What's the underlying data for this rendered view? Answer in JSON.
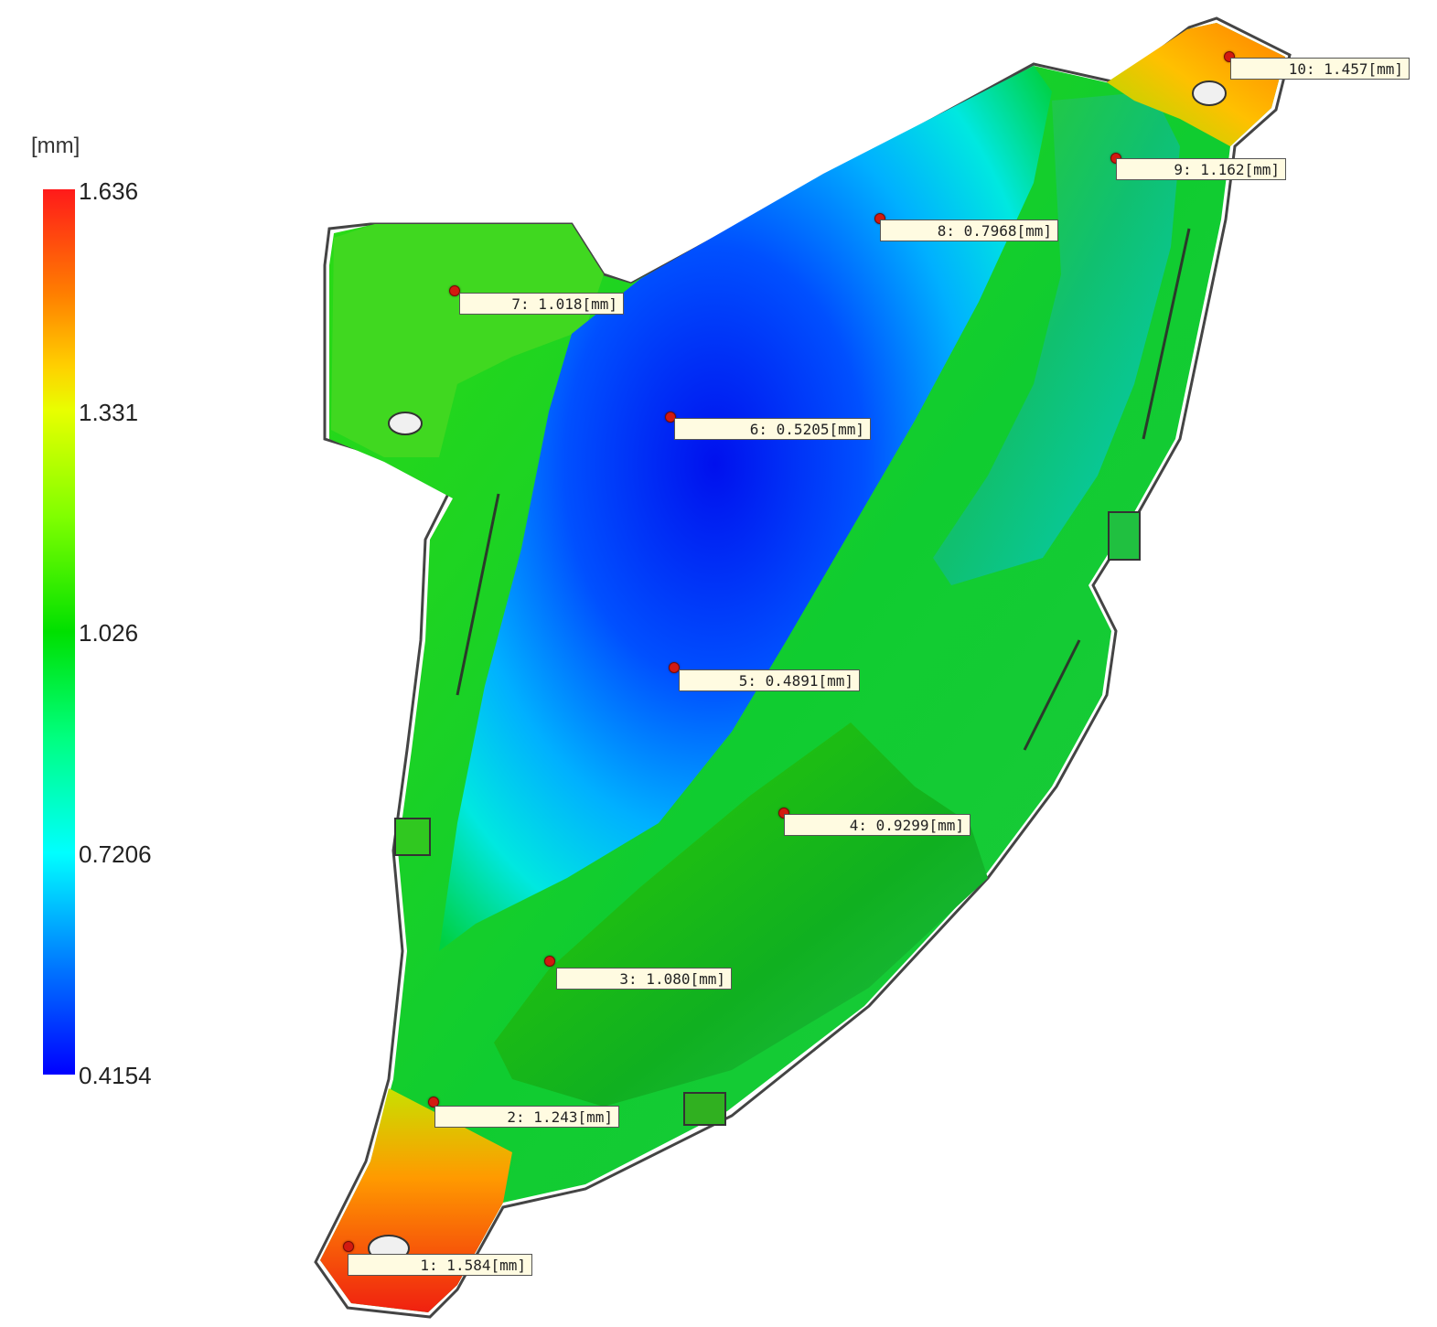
{
  "legend": {
    "unit": "[mm]",
    "max": "1.636",
    "tick2": "1.331",
    "mid": "1.026",
    "tick4": "0.7206",
    "min": "0.4154",
    "colors": [
      "#ff1a1a",
      "#ff8000",
      "#e8ff00",
      "#00e000",
      "#00ffff",
      "#0000ff"
    ]
  },
  "probes": [
    {
      "label": "1: 1.584[mm]"
    },
    {
      "label": "2: 1.243[mm]"
    },
    {
      "label": "3: 1.080[mm]"
    },
    {
      "label": "4: 0.9299[mm]"
    },
    {
      "label": "5: 0.4891[mm]"
    },
    {
      "label": "6: 0.5205[mm]"
    },
    {
      "label": "7: 1.018[mm]"
    },
    {
      "label": "8: 0.7968[mm]"
    },
    {
      "label": "9: 1.162[mm]"
    },
    {
      "label": "10: 1.457[mm]"
    }
  ]
}
